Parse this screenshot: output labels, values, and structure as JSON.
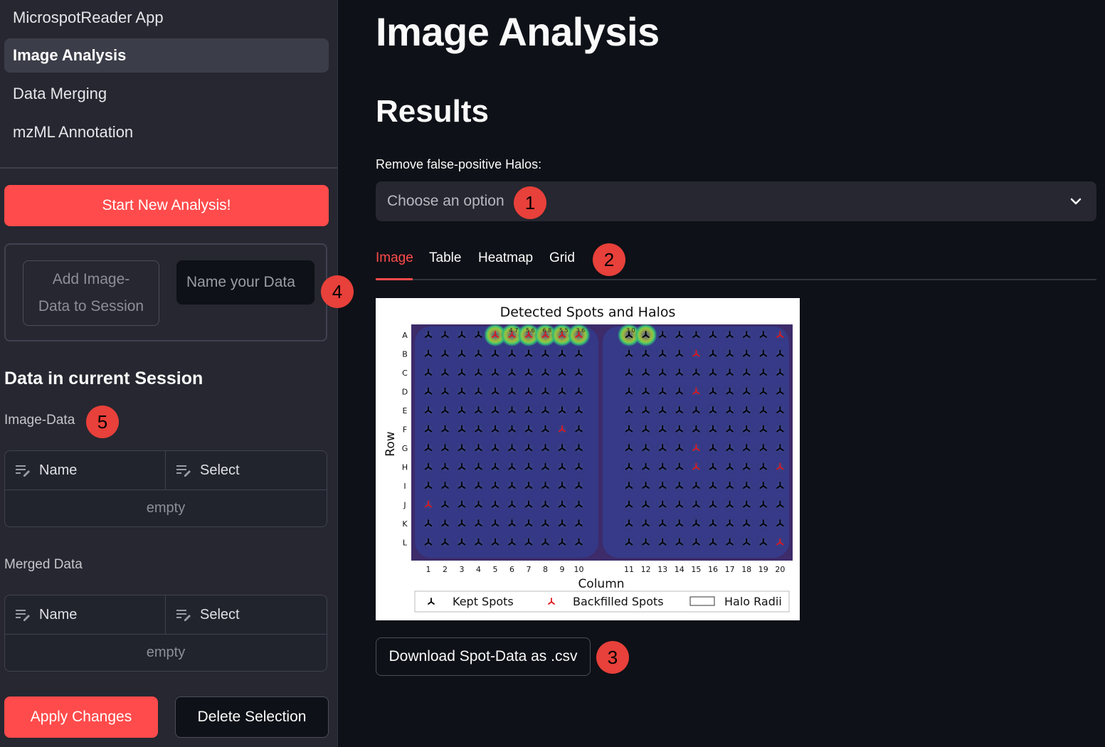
{
  "sidebar": {
    "nav": [
      {
        "label": "MicrospotReader App",
        "active": false
      },
      {
        "label": "Image Analysis",
        "active": true
      },
      {
        "label": "Data Merging",
        "active": false
      },
      {
        "label": "mzML Annotation",
        "active": false
      }
    ],
    "start_button": "Start New Analysis!",
    "add_button": "Add Image-\nData to Session",
    "name_placeholder": "Name your Data",
    "session_heading": "Data in current Session",
    "image_data": {
      "caption": "Image-Data",
      "columns": [
        "Name",
        "Select"
      ],
      "empty_text": "empty"
    },
    "merged_data": {
      "caption": "Merged Data",
      "columns": [
        "Name",
        "Select"
      ],
      "empty_text": "empty"
    },
    "apply_button": "Apply Changes",
    "delete_button": "Delete Selection"
  },
  "main": {
    "title": "Image Analysis",
    "results_heading": "Results",
    "filter_label": "Remove false-positive Halos:",
    "filter_placeholder": "Choose an option",
    "tabs": [
      "Image",
      "Table",
      "Heatmap",
      "Grid"
    ],
    "active_tab": "Image",
    "download_button": "Download Spot-Data as .csv"
  },
  "markers": [
    "1",
    "2",
    "3",
    "4",
    "5"
  ],
  "colors": {
    "primary": "#ff4b4b",
    "background": "#0e1117",
    "sidebar": "#262730",
    "marker": "#e8403a",
    "kept_spot": "#000000",
    "backfilled_spot": "#e0161b",
    "halo": "#f2ef3c"
  },
  "chart_data": {
    "type": "scatter",
    "title": "Detected Spots and Halos",
    "xlabel": "Column",
    "ylabel": "Row",
    "columns": [
      1,
      2,
      3,
      4,
      5,
      6,
      7,
      8,
      9,
      10,
      11,
      12,
      13,
      14,
      15,
      16,
      17,
      18,
      19,
      20
    ],
    "rows": [
      "A",
      "B",
      "C",
      "D",
      "E",
      "F",
      "G",
      "H",
      "I",
      "J",
      "K",
      "L"
    ],
    "series": [
      {
        "name": "Kept Spots",
        "marker": "tri_up",
        "color": "#000000"
      },
      {
        "name": "Backfilled Spots",
        "marker": "tri_up",
        "color": "#e0161b",
        "points": [
          [
            "A",
            5
          ],
          [
            "A",
            6
          ],
          [
            "A",
            7
          ],
          [
            "A",
            8
          ],
          [
            "A",
            9
          ],
          [
            "A",
            10
          ],
          [
            "A",
            20
          ],
          [
            "B",
            15
          ],
          [
            "D",
            15
          ],
          [
            "F",
            9
          ],
          [
            "G",
            15
          ],
          [
            "H",
            15
          ],
          [
            "H",
            20
          ],
          [
            "J",
            1
          ],
          [
            "L",
            20
          ]
        ]
      },
      {
        "name": "Halo Radii",
        "marker": "rect-outline",
        "color": "#000000",
        "points": [
          [
            "A",
            5
          ],
          [
            "A",
            6
          ],
          [
            "A",
            7
          ],
          [
            "A",
            8
          ],
          [
            "A",
            9
          ],
          [
            "A",
            10
          ],
          [
            "A",
            11
          ],
          [
            "A",
            12
          ]
        ]
      }
    ],
    "halo_labels": [
      "4.7",
      "5.6",
      "6.8",
      "5.5",
      "3.6",
      "3.0"
    ],
    "legend": "bottom"
  }
}
